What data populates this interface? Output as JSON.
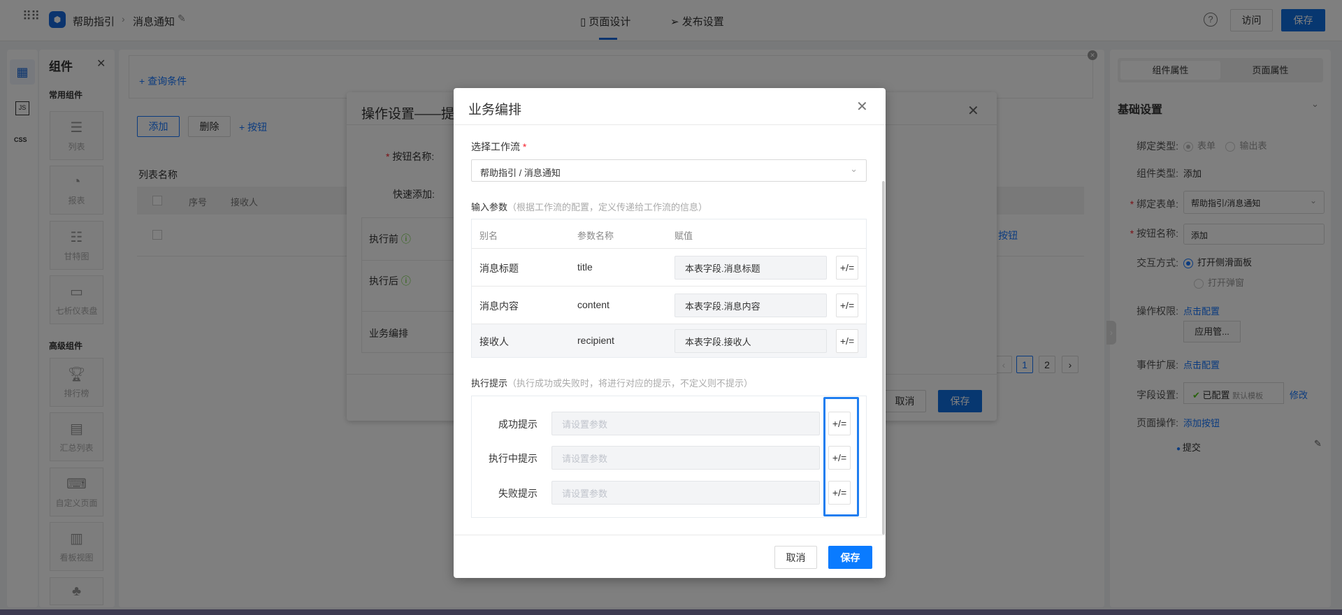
{
  "header": {
    "app_name": "帮助指引",
    "page_name": "消息通知",
    "tabs": [
      {
        "label": "页面设计",
        "active": true
      },
      {
        "label": "发布设置",
        "active": false
      }
    ],
    "visit_label": "访问",
    "save_label": "保存"
  },
  "components": {
    "title": "组件",
    "common_title": "常用组件",
    "common": [
      {
        "label": "列表",
        "icon": "list-icon"
      },
      {
        "label": "报表",
        "icon": "pie-chart-icon"
      },
      {
        "label": "甘特图",
        "icon": "gantt-icon"
      },
      {
        "label": "七析仪表盘",
        "icon": "dashboard-icon"
      }
    ],
    "advanced_title": "高级组件",
    "advanced": [
      {
        "label": "排行榜",
        "icon": "trophy-icon"
      },
      {
        "label": "汇总列表",
        "icon": "summary-list-icon"
      },
      {
        "label": "自定义页面",
        "icon": "terminal-icon"
      },
      {
        "label": "看板视图",
        "icon": "kanban-icon"
      },
      {
        "label": "",
        "icon": "org-chart-icon"
      }
    ]
  },
  "canvas": {
    "query_link": "+ 查询条件",
    "buttons": [
      "添加",
      "删除"
    ],
    "add_button_link": "+ 按钮",
    "list_title": "列表名称",
    "columns": [
      "序号",
      "接收人"
    ],
    "row_add_button": "+ 按钮",
    "pages": [
      "1",
      "2"
    ],
    "current_page": "1"
  },
  "op_dialog": {
    "title": "操作设置——提",
    "button_name_label": "按钮名称:",
    "quick_add_label": "快速添加:",
    "rows": [
      "执行前",
      "执行后",
      "业务编排"
    ],
    "cancel": "取消",
    "save": "保存"
  },
  "props": {
    "tabs": [
      "组件属性",
      "页面属性"
    ],
    "section": "基础设置",
    "bind_type_label": "绑定类型:",
    "bind_type_options": [
      "表单",
      "输出表"
    ],
    "comp_type_label": "组件类型:",
    "comp_type_value": "添加",
    "bind_form_label": "绑定表单:",
    "bind_form_value": "帮助指引/消息通知",
    "button_name_label": "按钮名称:",
    "button_name_value": "添加",
    "interaction_label": "交互方式:",
    "interaction_options": [
      "打开侧滑面板",
      "打开弹窗"
    ],
    "permission_label": "操作权限:",
    "permission_link": "点击配置",
    "permission_tag": "应用管...",
    "event_label": "事件扩展:",
    "event_link": "点击配置",
    "field_label": "字段设置:",
    "field_status": "已配置",
    "field_template": "默认模板",
    "field_edit": "修改",
    "page_op_label": "页面操作:",
    "page_op_link": "添加按钮",
    "page_op_item": "提交"
  },
  "modal": {
    "title": "业务编排",
    "workflow_label": "选择工作流",
    "workflow_value": "帮助指引 / 消息通知",
    "input_title": "输入参数",
    "input_hint": "（根据工作流的配置，定义传递给工作流的信息）",
    "columns": [
      "别名",
      "参数名称",
      "赋值"
    ],
    "params": [
      {
        "alias": "消息标题",
        "name": "title",
        "value": "本表字段.消息标题"
      },
      {
        "alias": "消息内容",
        "name": "content",
        "value": "本表字段.消息内容"
      },
      {
        "alias": "接收人",
        "name": "recipient",
        "value": "本表字段.接收人"
      }
    ],
    "expr_button": "+/=",
    "tips_title": "执行提示",
    "tips_hint": "（执行成功或失败时，将进行对应的提示，不定义则不提示）",
    "tips": [
      {
        "label": "成功提示",
        "placeholder": "请设置参数"
      },
      {
        "label": "执行中提示",
        "placeholder": "请设置参数"
      },
      {
        "label": "失败提示",
        "placeholder": "请设置参数"
      }
    ],
    "cancel": "取消",
    "save": "保存"
  },
  "colors": {
    "primary": "#0e6fe0",
    "highlight": "#1f7ef0",
    "required": "#f5222d"
  }
}
